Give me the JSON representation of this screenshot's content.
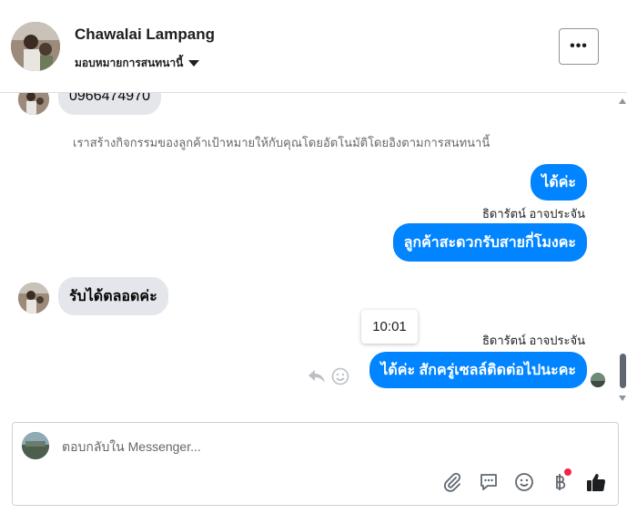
{
  "header": {
    "contact_name": "Chawalai Lampang",
    "assign_label": "มอบหมายการสนทนานี้",
    "more_label": "•••"
  },
  "messages": {
    "phone_bubble": "0966474970",
    "system_note": "เราสร้างกิจกรรมของลูกค้าเป้าหมายให้กับคุณโดยอัตโนมัติโดยอิงตามการสนทนานี้",
    "out_1": "ได้ค่ะ",
    "sender_1": "ธิดารัตน์ อาจประจัน",
    "out_2": "ลูกค้าสะดวกรับสายกี่โมงคะ",
    "in_1": "รับได้ตลอดค่ะ",
    "tooltip_time": "10:01",
    "sender_2": "ธิดารัตน์ อาจประจัน",
    "out_3": "ได้ค่ะ สักครู่เซลล์ติดต่อไปนะคะ"
  },
  "composer": {
    "placeholder": "ตอบกลับใน Messenger...",
    "value": "",
    "icons": [
      "paperclip-icon",
      "comment-icon",
      "smiley-icon",
      "baht-icon",
      "thumbs-up-icon"
    ]
  },
  "colors": {
    "outgoing_bubble": "#0084ff",
    "incoming_bubble": "#e4e6eb",
    "badge": "#f02849"
  }
}
